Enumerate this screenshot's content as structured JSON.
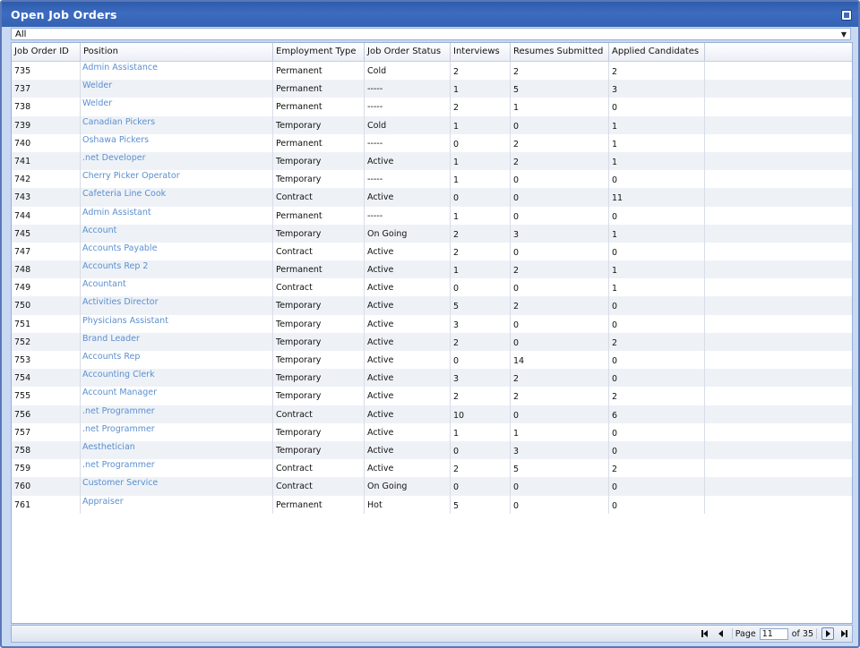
{
  "window": {
    "title": "Open Job Orders"
  },
  "filter": {
    "selected": "All"
  },
  "grid": {
    "columns": [
      "Job Order ID",
      "Position",
      "Employment Type",
      "Job Order Status",
      "Interviews",
      "Resumes Submitted",
      "Applied Candidates"
    ],
    "rows": [
      {
        "id": "735",
        "position": "Admin Assistance",
        "type": "Permanent",
        "status": "Cold",
        "interviews": "2",
        "resumes": "2",
        "applied": "2"
      },
      {
        "id": "737",
        "position": "Welder",
        "type": "Permanent",
        "status": "-----",
        "interviews": "1",
        "resumes": "5",
        "applied": "3"
      },
      {
        "id": "738",
        "position": "Welder",
        "type": "Permanent",
        "status": "-----",
        "interviews": "2",
        "resumes": "1",
        "applied": "0"
      },
      {
        "id": "739",
        "position": "Canadian Pickers",
        "type": "Temporary",
        "status": "Cold",
        "interviews": "1",
        "resumes": "0",
        "applied": "1"
      },
      {
        "id": "740",
        "position": "Oshawa Pickers",
        "type": "Permanent",
        "status": "-----",
        "interviews": "0",
        "resumes": "2",
        "applied": "1"
      },
      {
        "id": "741",
        "position": ".net Developer",
        "type": "Temporary",
        "status": "Active",
        "interviews": "1",
        "resumes": "2",
        "applied": "1"
      },
      {
        "id": "742",
        "position": "Cherry Picker Operator",
        "type": "Temporary",
        "status": "-----",
        "interviews": "1",
        "resumes": "0",
        "applied": "0"
      },
      {
        "id": "743",
        "position": "Cafeteria Line Cook",
        "type": "Contract",
        "status": "Active",
        "interviews": "0",
        "resumes": "0",
        "applied": "11"
      },
      {
        "id": "744",
        "position": "Admin Assistant",
        "type": "Permanent",
        "status": "-----",
        "interviews": "1",
        "resumes": "0",
        "applied": "0"
      },
      {
        "id": "745",
        "position": "Account",
        "type": "Temporary",
        "status": "On Going",
        "interviews": "2",
        "resumes": "3",
        "applied": "1"
      },
      {
        "id": "747",
        "position": "Accounts Payable",
        "type": "Contract",
        "status": "Active",
        "interviews": "2",
        "resumes": "0",
        "applied": "0"
      },
      {
        "id": "748",
        "position": "Accounts Rep 2",
        "type": "Permanent",
        "status": "Active",
        "interviews": "1",
        "resumes": "2",
        "applied": "1"
      },
      {
        "id": "749",
        "position": "Acountant",
        "type": "Contract",
        "status": "Active",
        "interviews": "0",
        "resumes": "0",
        "applied": "1"
      },
      {
        "id": "750",
        "position": "Activities Director",
        "type": "Temporary",
        "status": "Active",
        "interviews": "5",
        "resumes": "2",
        "applied": "0"
      },
      {
        "id": "751",
        "position": "Physicians Assistant",
        "type": "Temporary",
        "status": "Active",
        "interviews": "3",
        "resumes": "0",
        "applied": "0"
      },
      {
        "id": "752",
        "position": "Brand Leader",
        "type": "Temporary",
        "status": "Active",
        "interviews": "2",
        "resumes": "0",
        "applied": "2"
      },
      {
        "id": "753",
        "position": "Accounts Rep",
        "type": "Temporary",
        "status": "Active",
        "interviews": "0",
        "resumes": "14",
        "applied": "0"
      },
      {
        "id": "754",
        "position": "Accounting Clerk",
        "type": "Temporary",
        "status": "Active",
        "interviews": "3",
        "resumes": "2",
        "applied": "0"
      },
      {
        "id": "755",
        "position": "Account Manager",
        "type": "Temporary",
        "status": "Active",
        "interviews": "2",
        "resumes": "2",
        "applied": "2"
      },
      {
        "id": "756",
        "position": ".net Programmer",
        "type": "Contract",
        "status": "Active",
        "interviews": "10",
        "resumes": "0",
        "applied": "6"
      },
      {
        "id": "757",
        "position": ".net Programmer",
        "type": "Temporary",
        "status": "Active",
        "interviews": "1",
        "resumes": "1",
        "applied": "0"
      },
      {
        "id": "758",
        "position": "Aesthetician",
        "type": "Temporary",
        "status": "Active",
        "interviews": "0",
        "resumes": "3",
        "applied": "0"
      },
      {
        "id": "759",
        "position": ".net Programmer",
        "type": "Contract",
        "status": "Active",
        "interviews": "2",
        "resumes": "5",
        "applied": "2"
      },
      {
        "id": "760",
        "position": "Customer Service",
        "type": "Contract",
        "status": "On Going",
        "interviews": "0",
        "resumes": "0",
        "applied": "0"
      },
      {
        "id": "761",
        "position": "Appraiser",
        "type": "Permanent",
        "status": "Hot",
        "interviews": "5",
        "resumes": "0",
        "applied": "0"
      }
    ]
  },
  "pager": {
    "page_label": "Page",
    "current_page": "11",
    "of_label": "of 35"
  },
  "icons": {
    "window_tool": "maximize-icon",
    "dropdown": "chevron-down-icon",
    "first": "first-page-icon",
    "prev": "prev-page-icon",
    "next": "next-page-icon",
    "last": "last-page-icon"
  },
  "colors": {
    "titlebar": "#3462b3",
    "link": "#5b8fcf",
    "alt_row": "#eef2f7"
  }
}
